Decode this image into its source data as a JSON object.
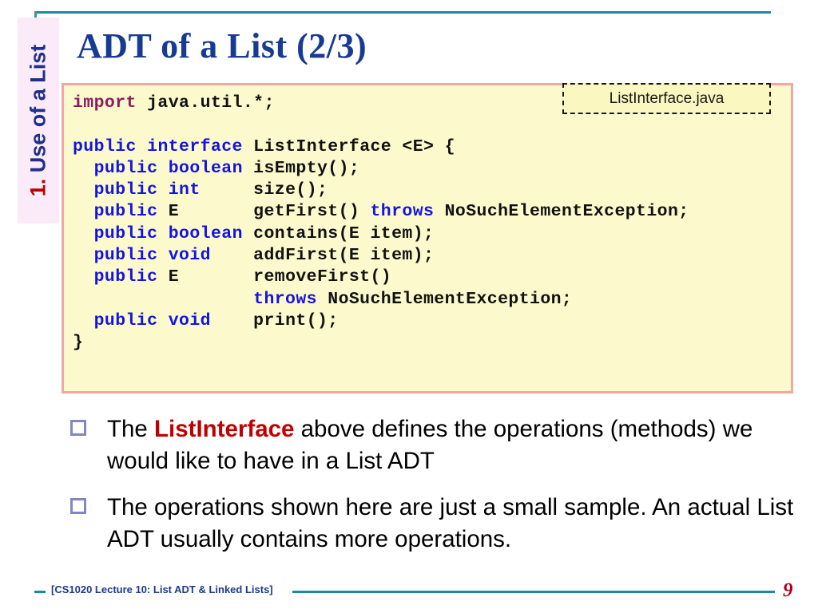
{
  "slide": {
    "title": "ADT of a List (2/3)",
    "page_number": "9",
    "footer_label": "[CS1020 Lecture 10: List ADT & Linked Lists]"
  },
  "section_tab": {
    "number": "1.",
    "label": "Use of a List",
    "full_text": "1. Use of a List"
  },
  "code_block": {
    "file_label": "ListInterface.java",
    "language": "java",
    "lines": [
      "import java.util.*;",
      "",
      "public interface ListInterface <E> {",
      "  public boolean isEmpty();",
      "  public int     size();",
      "  public E       getFirst() throws NoSuchElementException;",
      "  public boolean contains(E item);",
      "  public void    addFirst(E item);",
      "  public E       removeFirst()",
      "                 throws NoSuchElementException;",
      "  public void    print();",
      "}"
    ]
  },
  "bullets": [
    {
      "prefix": "The ",
      "highlight": "ListInterface",
      "suffix": " above defines the operations (methods) we would like to have in a List ADT",
      "full_text": "The ListInterface above defines the operations (methods) we would like to have in a List ADT"
    },
    {
      "prefix": "",
      "highlight": "",
      "suffix": "The operations shown here are just a small sample. An actual List ADT usually contains more operations.",
      "full_text": "The operations shown here are just a small sample. An actual List ADT usually contains more operations."
    }
  ],
  "colors": {
    "title": "#173a93",
    "accent_rule": "#1b8c99",
    "code_bg": "#fcfacd",
    "code_border": "#f4a6a2",
    "keyword": "#1414e0",
    "import_keyword": "#8e1a62",
    "highlight_red": "#c00000",
    "section_tab_bg": "#fbeaf7",
    "bullet_marker": "#8387bf",
    "page_number": "#b00020"
  }
}
